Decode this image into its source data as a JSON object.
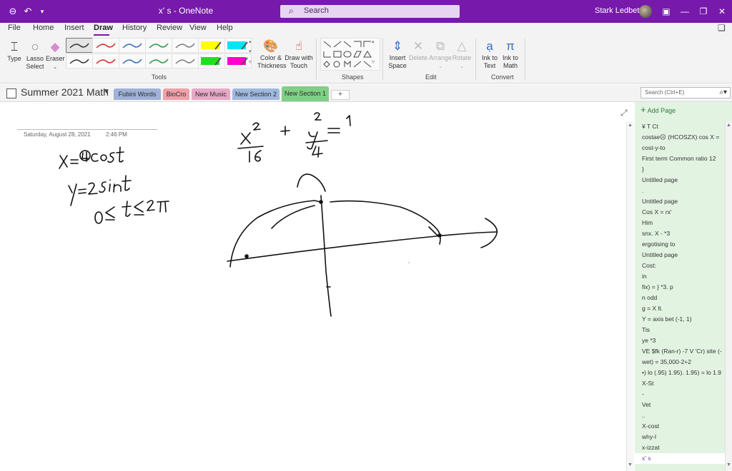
{
  "titlebar": {
    "doc_title": "x' s  -  OneNote",
    "search_label": "Search",
    "user_name": "Stark Ledbetter"
  },
  "menu": {
    "items": [
      "File",
      "Home",
      "Insert",
      "Draw",
      "History",
      "Review",
      "View",
      "Help"
    ],
    "active": "Draw"
  },
  "ribbon": {
    "type_label": "Type",
    "lasso_label_1": "Lasso",
    "lasso_label_2": "Select",
    "eraser_label": "Eraser",
    "color_label_1": "Color &",
    "color_label_2": "Thickness",
    "draw_touch_1": "Draw with",
    "draw_touch_2": "Touch",
    "insert_space_1": "Insert",
    "insert_space_2": "Space",
    "delete_label": "Delete",
    "arrange_label": "Arrange",
    "rotate_label": "Rotate",
    "ink_text_1": "Ink to",
    "ink_text_2": "Text",
    "ink_math_1": "Ink to",
    "ink_math_2": "Math",
    "groups": {
      "tools": "Tools",
      "shapes": "Shapes",
      "edit": "Edit",
      "convert": "Convert"
    },
    "pen_colors": [
      "#3a3a3a",
      "#d23030",
      "#3a6fc0",
      "#2e9a4a",
      "#808080",
      "#ffff00",
      "#00e5f5",
      "#3a3a3a",
      "#d23030",
      "#3a6fc0",
      "#2e9a4a",
      "#808080",
      "#22dd22",
      "#ff00cc"
    ]
  },
  "notebook": {
    "name": "Summer 2021 Math",
    "sections": [
      {
        "label": "Fubini Words",
        "color": "#9fb1d8"
      },
      {
        "label": "BioCro",
        "color": "#f0a0a8"
      },
      {
        "label": "New Music",
        "color": "#e8a8c8"
      },
      {
        "label": "New Section 2",
        "color": "#9fb8de"
      },
      {
        "label": "New Section 1",
        "color": "#7fcf85"
      }
    ],
    "add_tab": "+",
    "search_placeholder": "Search (Ctrl+E)"
  },
  "page": {
    "date": "Saturday, August 28, 2021",
    "time": "2:46 PM"
  },
  "pane": {
    "add_page": "Add Page",
    "pages": [
      "¥ T Ct",
      "costae☹ (HCOSZX) cos X =",
      "cost-y-to",
      "First term Common ratio  12",
      "}",
      "Untitled page",
      ".",
      "Untitled page",
      "Cos X = rx'",
      "Him",
      "snx. X - *3",
      "ergotising to",
      "Untitled page",
      "Cost:",
      "in",
      "fix) = } *3. p",
      "n odd",
      "g = X lt.",
      "Y = axis bet (-1, 1)",
      "Tis",
      "ye *3",
      "VE $fk (Ran-r) -7 V 'Cr) site (-",
      "wet) = 35,000-2+2",
      "•) lo (.95) 1.95). 1.95) = lo 1.9",
      "X-St",
      "-",
      "Vet",
      "..",
      "X-cost",
      "why-l",
      "x-izzat",
      "x' s"
    ],
    "selected_index": 31
  }
}
